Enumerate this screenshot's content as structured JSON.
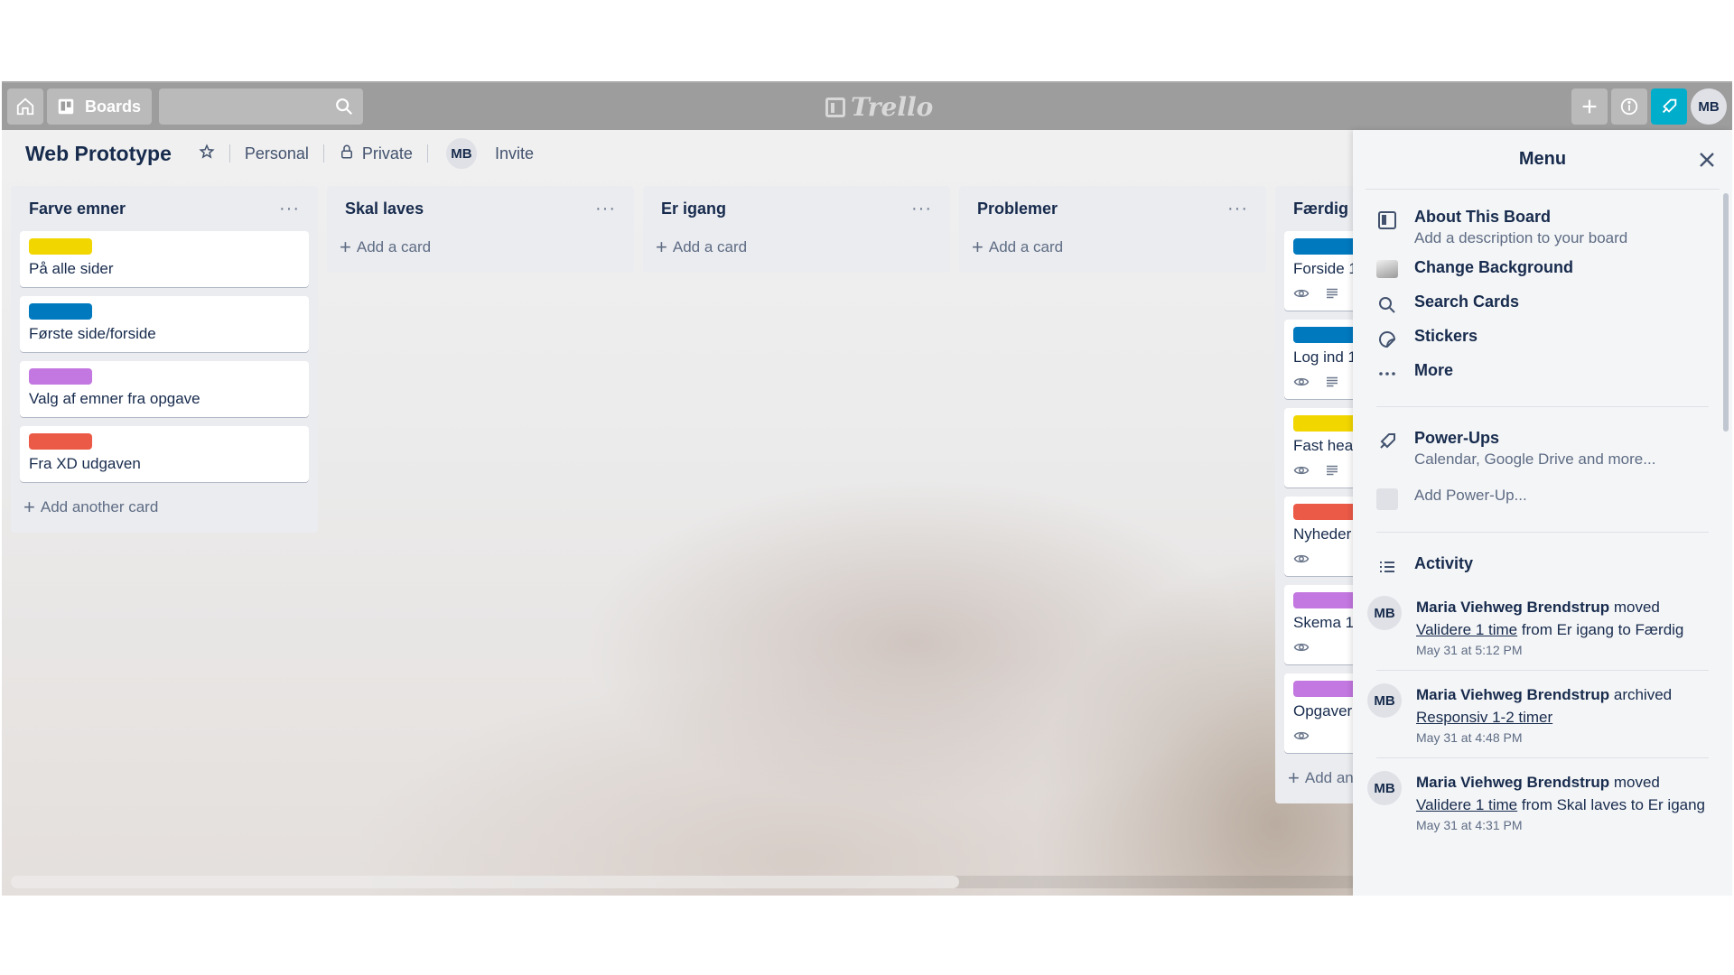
{
  "topbar": {
    "boards_label": "Boards",
    "search_placeholder": "",
    "logo_text": "Trello",
    "avatar_initials": "MB",
    "notif_color": "#00aecc"
  },
  "board": {
    "title": "Web Prototype",
    "team": "Personal",
    "visibility": "Private",
    "member_initials": "MB",
    "invite_label": "Invite"
  },
  "lists": [
    {
      "title": "Farve emner",
      "menu": "···",
      "cards": [
        {
          "label_color": "#f2d600",
          "title": "På alle sider"
        },
        {
          "label_color": "#0079bf",
          "title": "Første side/forside"
        },
        {
          "label_color": "#c377e0",
          "title": "Valg af emner fra opgave"
        },
        {
          "label_color": "#eb5a46",
          "title": "Fra XD udgaven"
        }
      ],
      "add_label": "Add another card"
    },
    {
      "title": "Skal laves",
      "menu": "···",
      "cards": [],
      "add_label": "Add a card"
    },
    {
      "title": "Er igang",
      "menu": "···",
      "cards": [],
      "add_label": "Add a card"
    },
    {
      "title": "Problemer",
      "menu": "···",
      "cards": [],
      "add_label": "Add a card"
    },
    {
      "title": "Færdig",
      "menu": "···",
      "cards": [
        {
          "label_color": "#0079bf",
          "title": "Forside 1",
          "badges": [
            "eye-icon",
            "description-icon"
          ]
        },
        {
          "label_color": "#0079bf",
          "title": "Log ind 1",
          "badges": [
            "eye-icon",
            "description-icon"
          ]
        },
        {
          "label_color": "#f2d600",
          "title": "Fast header",
          "badges": [
            "eye-icon",
            "description-icon"
          ]
        },
        {
          "label_color": "#eb5a46",
          "title": "Nyheder",
          "badges": [
            "eye-icon"
          ]
        },
        {
          "label_color": "#c377e0",
          "title": "Skema 1",
          "badges": [
            "eye-icon"
          ]
        },
        {
          "label_color": "#c377e0",
          "title": "Opgaver",
          "badges": [
            "eye-icon"
          ]
        }
      ],
      "add_label": "Add another card"
    }
  ],
  "menu": {
    "title": "Menu",
    "about_title": "About This Board",
    "about_sub": "Add a description to your board",
    "change_bg": "Change Background",
    "search_cards": "Search Cards",
    "stickers": "Stickers",
    "more": "More",
    "powerups_title": "Power-Ups",
    "powerups_sub": "Calendar, Google Drive and more...",
    "add_powerup": "Add Power-Up...",
    "activity_title": "Activity",
    "activities": [
      {
        "initials": "MB",
        "user": "Maria Viehweg Brendstrup",
        "action": " moved ",
        "card": "Validere 1 time",
        "rest": " from Er igang to Færdig",
        "time": "May 31 at 5:12 PM"
      },
      {
        "initials": "MB",
        "user": "Maria Viehweg Brendstrup",
        "action": " archived ",
        "card": "Responsiv 1-2 timer",
        "rest": "",
        "time": "May 31 at 4:48 PM"
      },
      {
        "initials": "MB",
        "user": "Maria Viehweg Brendstrup",
        "action": " moved ",
        "card": "Validere 1 time",
        "rest": " from Skal laves to Er igang",
        "time": "May 31 at 4:31 PM"
      }
    ]
  }
}
